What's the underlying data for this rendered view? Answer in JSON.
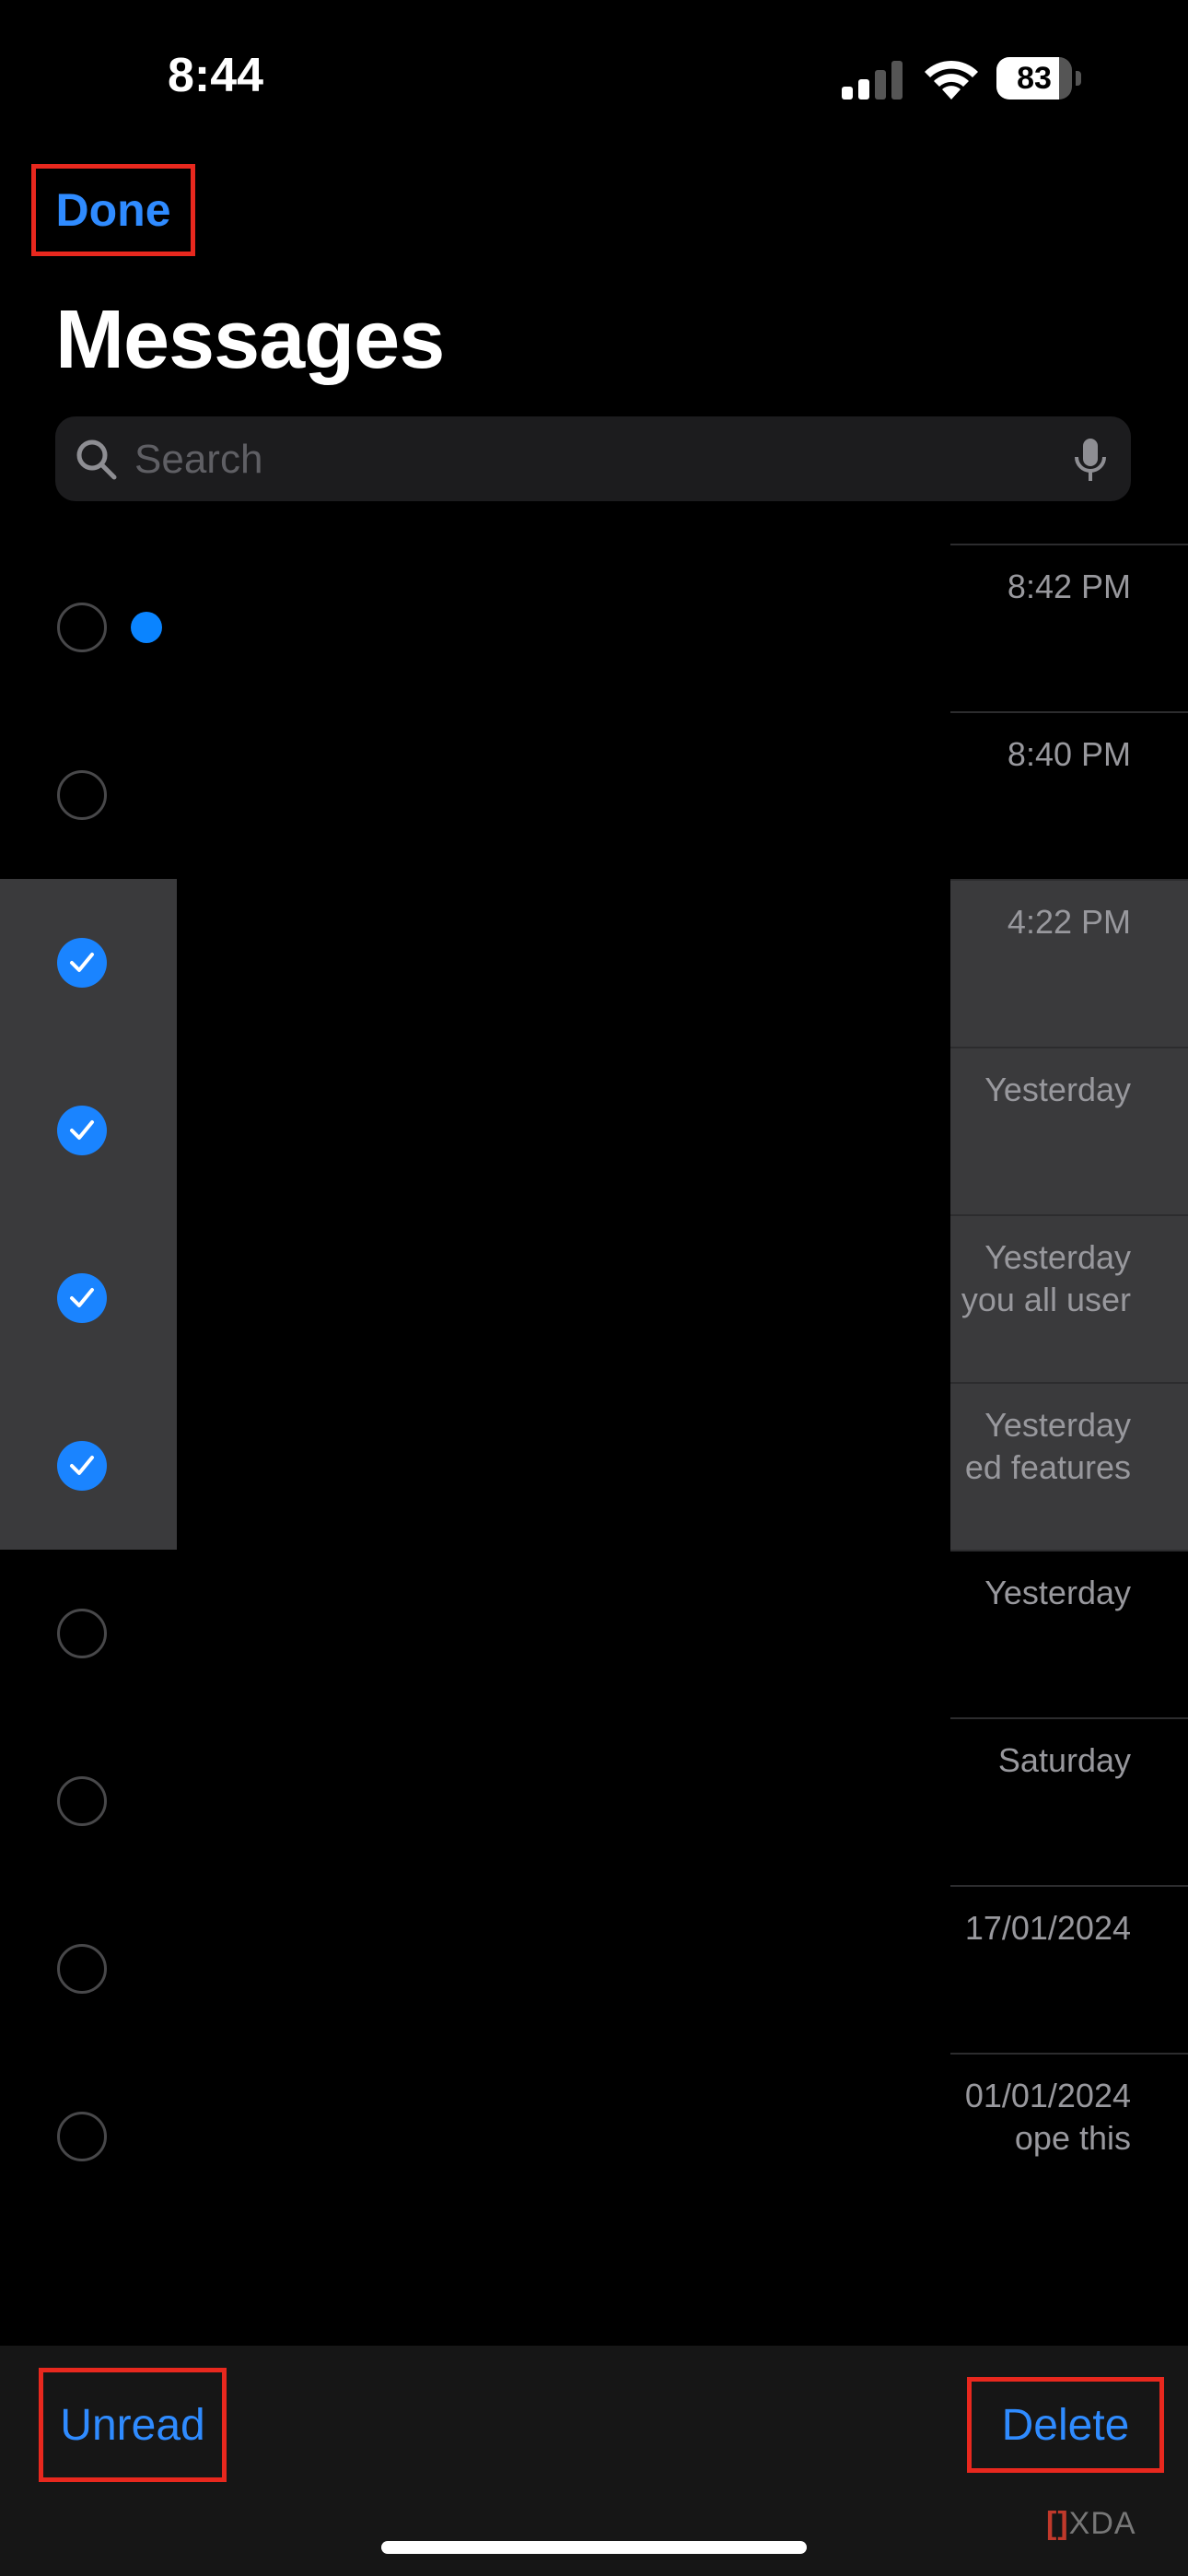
{
  "status_bar": {
    "time": "8:44",
    "battery_level": "83",
    "battery_fraction": 0.83,
    "icons": [
      "cellular-signal-icon",
      "wifi-icon",
      "battery-icon"
    ]
  },
  "nav": {
    "done_label": "Done"
  },
  "header": {
    "title": "Messages"
  },
  "search": {
    "placeholder": "Search",
    "value": "",
    "icons": [
      "search-icon",
      "microphone-icon"
    ]
  },
  "conversations": [
    {
      "time": "8:42 PM",
      "snippet": "",
      "selected": false,
      "unread": true
    },
    {
      "time": "8:40 PM",
      "snippet": "",
      "selected": false,
      "unread": false
    },
    {
      "time": "4:22 PM",
      "snippet": "",
      "selected": true,
      "unread": false
    },
    {
      "time": "Yesterday",
      "snippet": "",
      "selected": true,
      "unread": false
    },
    {
      "time": "Yesterday",
      "snippet": "you all user",
      "selected": true,
      "unread": false
    },
    {
      "time": "Yesterday",
      "snippet": "ed features",
      "selected": true,
      "unread": false
    },
    {
      "time": "Yesterday",
      "snippet": "",
      "selected": false,
      "unread": false
    },
    {
      "time": "Saturday",
      "snippet": "",
      "selected": false,
      "unread": false
    },
    {
      "time": "17/01/2024",
      "snippet": "",
      "selected": false,
      "unread": false
    },
    {
      "time": "01/01/2024",
      "snippet": "ope this",
      "selected": false,
      "unread": false
    }
  ],
  "toolbar": {
    "unread_label": "Unread",
    "delete_label": "Delete"
  },
  "watermark": {
    "bracket": "[]",
    "text": "XDA"
  },
  "colors": {
    "accent": "#2f8bff",
    "highlight_box": "#e8281e",
    "selected_row": "#3a3a3c",
    "background": "#000000"
  }
}
